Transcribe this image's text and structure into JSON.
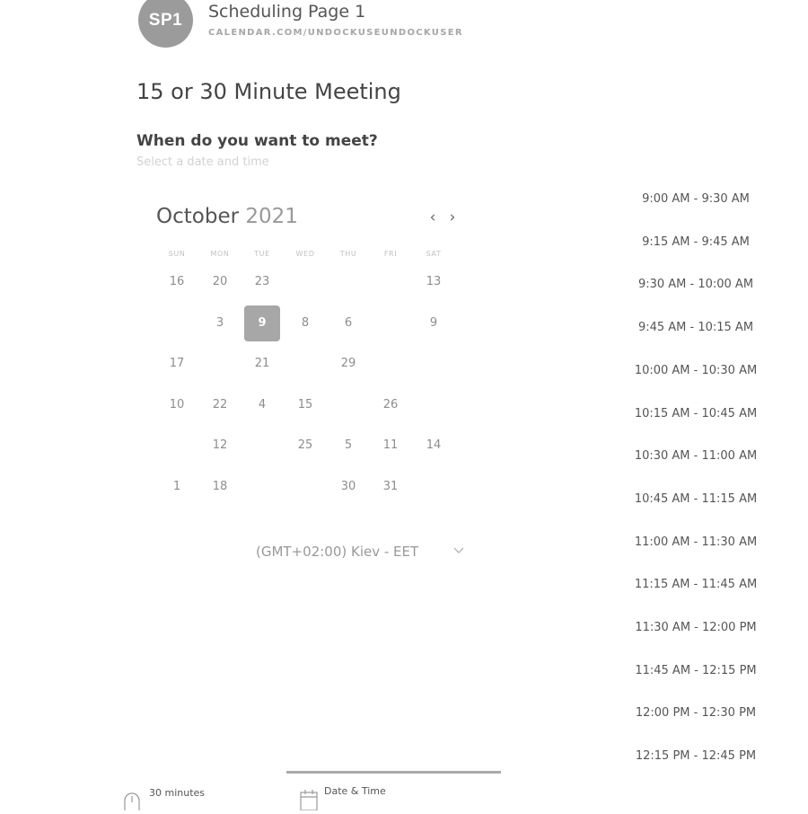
{
  "header": {
    "avatar": "SP1",
    "page_name": "Scheduling Page 1",
    "page_url": "CALENDAR.COM/UNDOCKUSEUNDOCKUSER"
  },
  "meeting_title": "15 or 30 Minute Meeting",
  "question": "When do you want to meet?",
  "subtitle": "Select a date and time",
  "calendar": {
    "month": "October",
    "year": "2021",
    "prev_icon": "‹",
    "next_icon": "›",
    "weekdays": [
      "SUN",
      "MON",
      "TUE",
      "WED",
      "THU",
      "FRI",
      "SAT"
    ],
    "rows": [
      [
        "16",
        "20",
        "23",
        "",
        "",
        "",
        "13"
      ],
      [
        "",
        "3",
        "9",
        "8",
        "6",
        "",
        "9"
      ],
      [
        "17",
        "",
        "21",
        "",
        "29",
        "",
        ""
      ],
      [
        "10",
        "22",
        "4",
        "15",
        "",
        "26",
        ""
      ],
      [
        "",
        "12",
        "",
        "25",
        "5",
        "11",
        "14"
      ],
      [
        "1",
        "18",
        "",
        "",
        "30",
        "31",
        ""
      ]
    ],
    "selected": "9"
  },
  "timezone": "(GMT+02:00) Kiev - EET",
  "time_slots": [
    "9:00 AM - 9:30 AM",
    "9:15 AM - 9:45 AM",
    "9:30 AM - 10:00 AM",
    "9:45 AM - 10:15 AM",
    "10:00 AM - 10:30 AM",
    "10:15 AM - 10:45 AM",
    "10:30 AM - 11:00 AM",
    "10:45 AM - 11:15 AM",
    "11:00 AM - 11:30 AM",
    "11:15 AM - 11:45 AM",
    "11:30 AM - 12:00 PM",
    "11:45 AM - 12:15 PM",
    "12:00 PM - 12:30 PM",
    "12:15 PM - 12:45 PM"
  ],
  "bottom": {
    "duration_label": "30 minutes",
    "datetime_label": "Date & Time"
  },
  "icons": {
    "clock": "clock-icon",
    "calendar": "calendar-icon",
    "chevron": "chevron-down-icon"
  }
}
